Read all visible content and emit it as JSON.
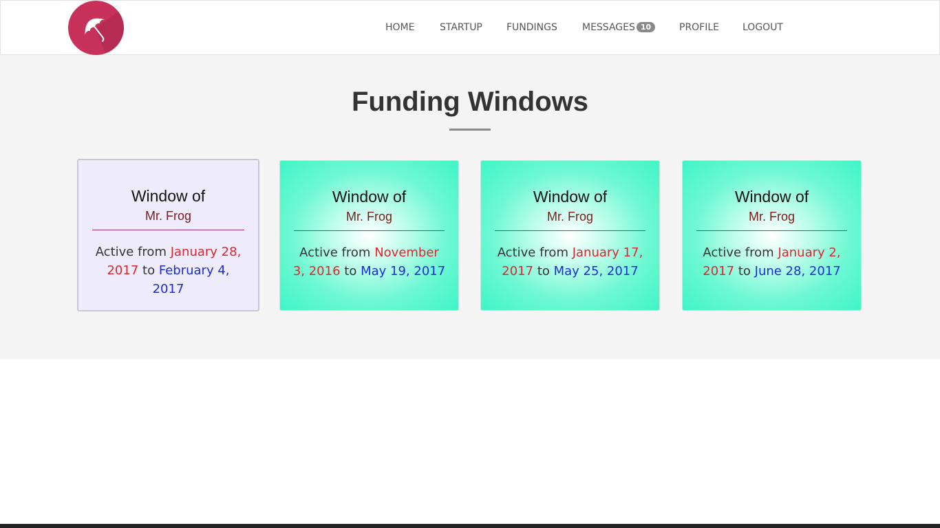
{
  "nav": {
    "items": [
      {
        "label": "HOME"
      },
      {
        "label": "STARTUP"
      },
      {
        "label": "FUNDINGS"
      },
      {
        "label": "MESSAGES",
        "badge": "10"
      },
      {
        "label": "PROFILE"
      },
      {
        "label": "LOGOUT"
      }
    ]
  },
  "logo": {
    "icon": "umbrella-icon",
    "color": "#c8325a"
  },
  "page": {
    "title": "Funding Windows"
  },
  "cards": [
    {
      "title": "Window of",
      "owner": "Mr. Frog",
      "prefix": "Active from",
      "start": "January 28, 2017",
      "connector": "to",
      "end": "February 4, 2017"
    },
    {
      "title": "Window of",
      "owner": "Mr. Frog",
      "prefix": "Active from",
      "start": "November 3, 2016",
      "connector": "to",
      "end": "May 19, 2017"
    },
    {
      "title": "Window of",
      "owner": "Mr. Frog",
      "prefix": "Active from",
      "start": "January 17, 2017",
      "connector": "to",
      "end": "May 25, 2017"
    },
    {
      "title": "Window of",
      "owner": "Mr. Frog",
      "prefix": "Active from",
      "start": "January 2, 2017",
      "connector": "to",
      "end": "June 28, 2017"
    }
  ],
  "colors": {
    "start_date": "#e0242e",
    "end_date": "#1b2bd8",
    "card_mint": "#3ff5c6",
    "card_selected": "#eeecfb"
  }
}
